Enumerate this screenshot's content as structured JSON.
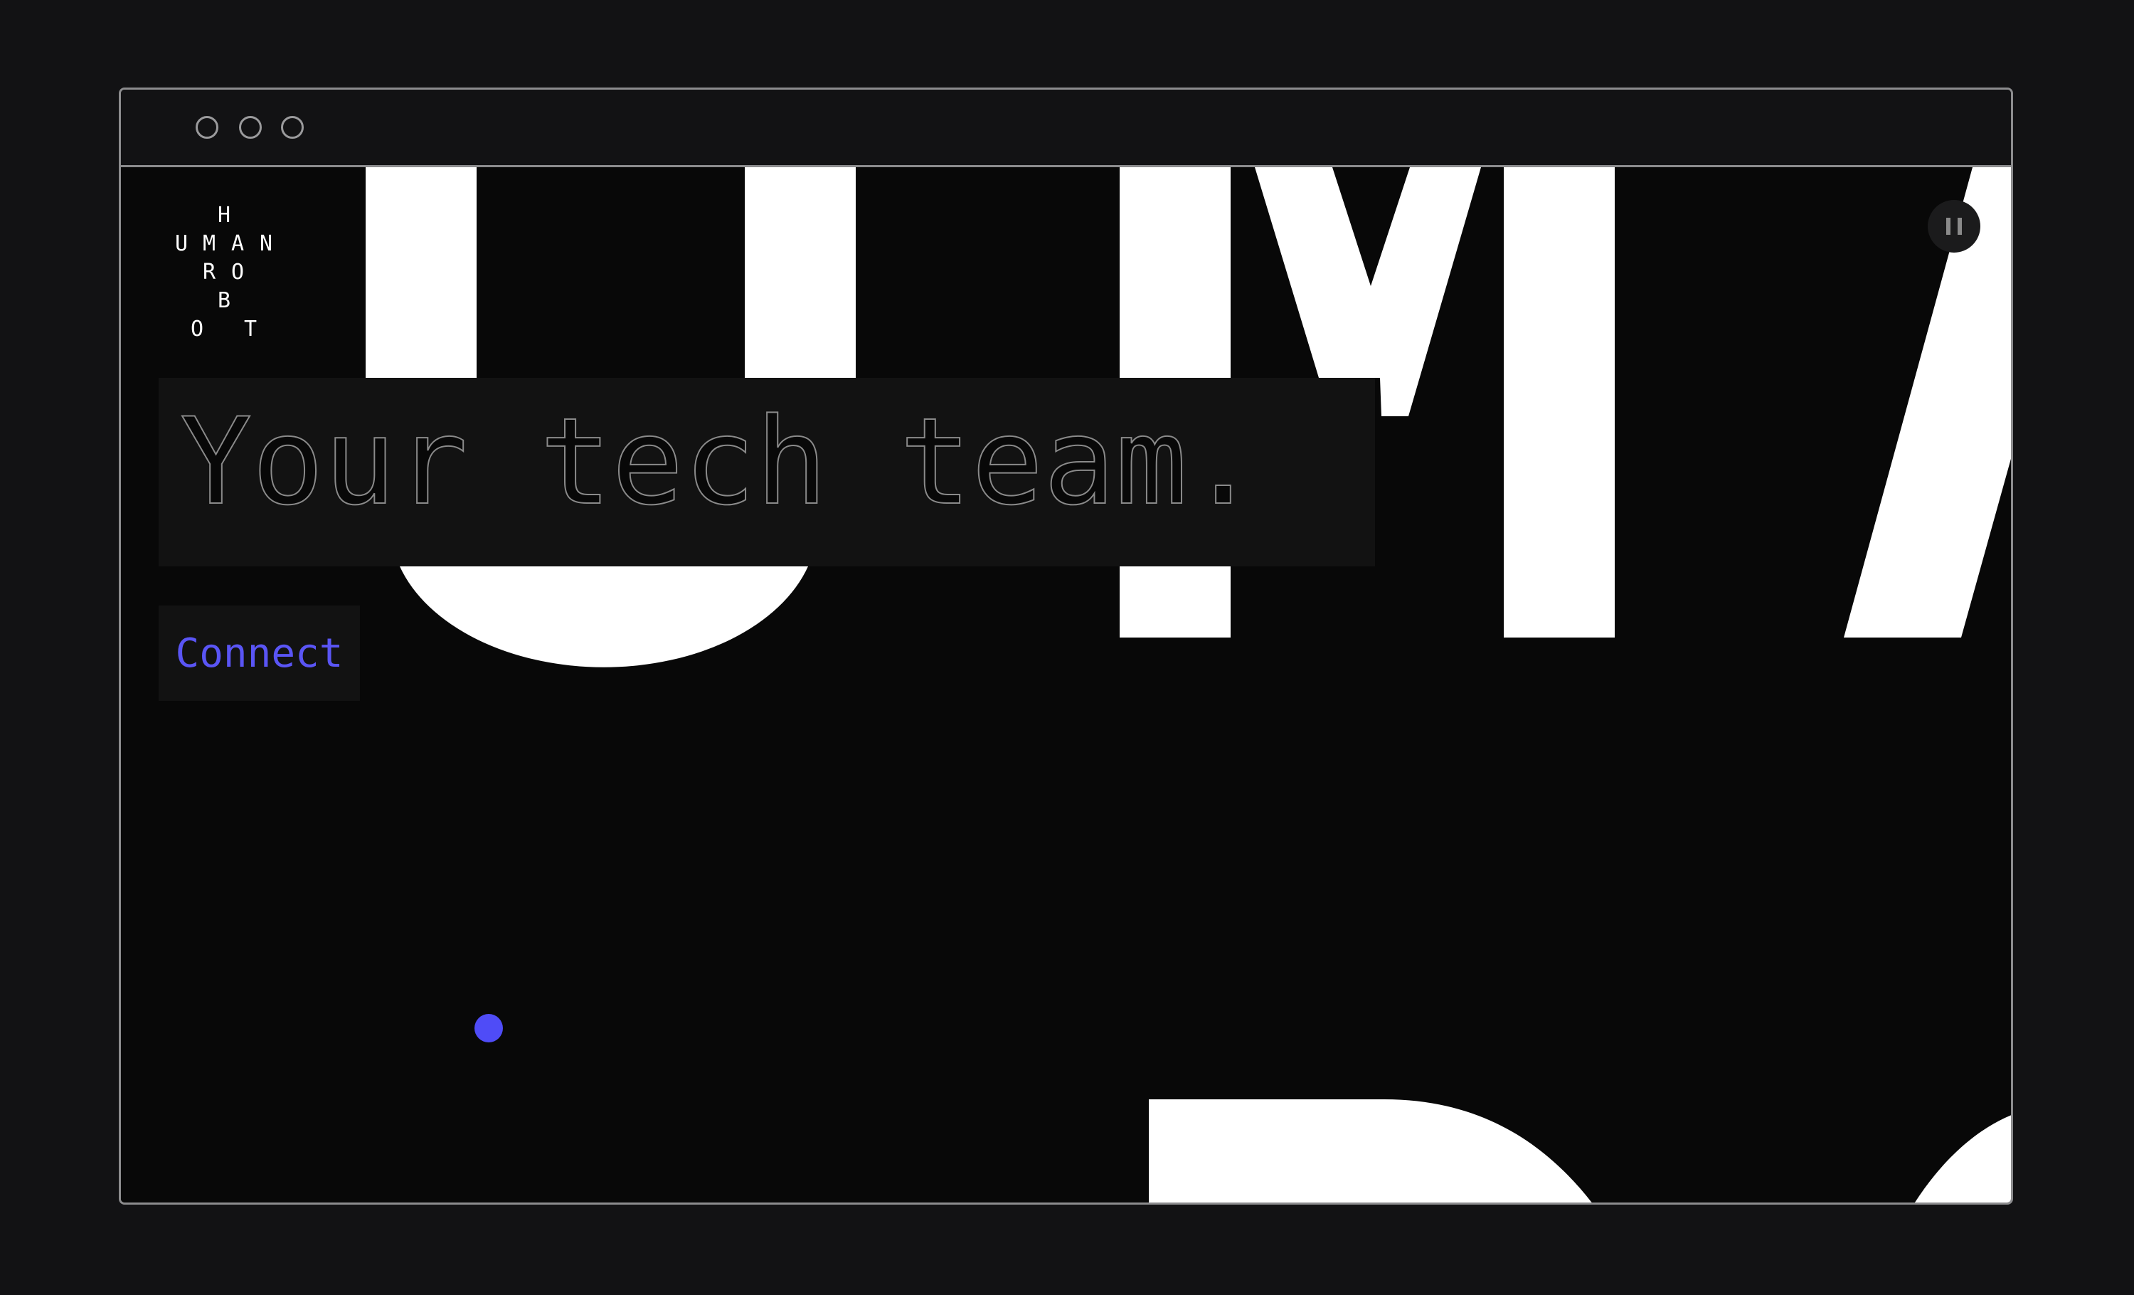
{
  "window": {
    "controls": [
      "window-dot",
      "window-dot",
      "window-dot"
    ]
  },
  "logo": {
    "letters": [
      "H",
      "U",
      "M",
      "A",
      "N",
      "R",
      "O",
      "B",
      "O",
      "T"
    ]
  },
  "hero": {
    "headline": "Your tech team.",
    "cta_label": "Connect"
  },
  "controls": {
    "pause_icon": "pause-icon"
  },
  "colors": {
    "page_background": "#121214",
    "viewport_background": "#080808",
    "accent": "#5a55f5",
    "cursor_dot": "#4f4cf7",
    "letterforms": "#ffffff",
    "headline_stroke": "#8a8a8a"
  }
}
